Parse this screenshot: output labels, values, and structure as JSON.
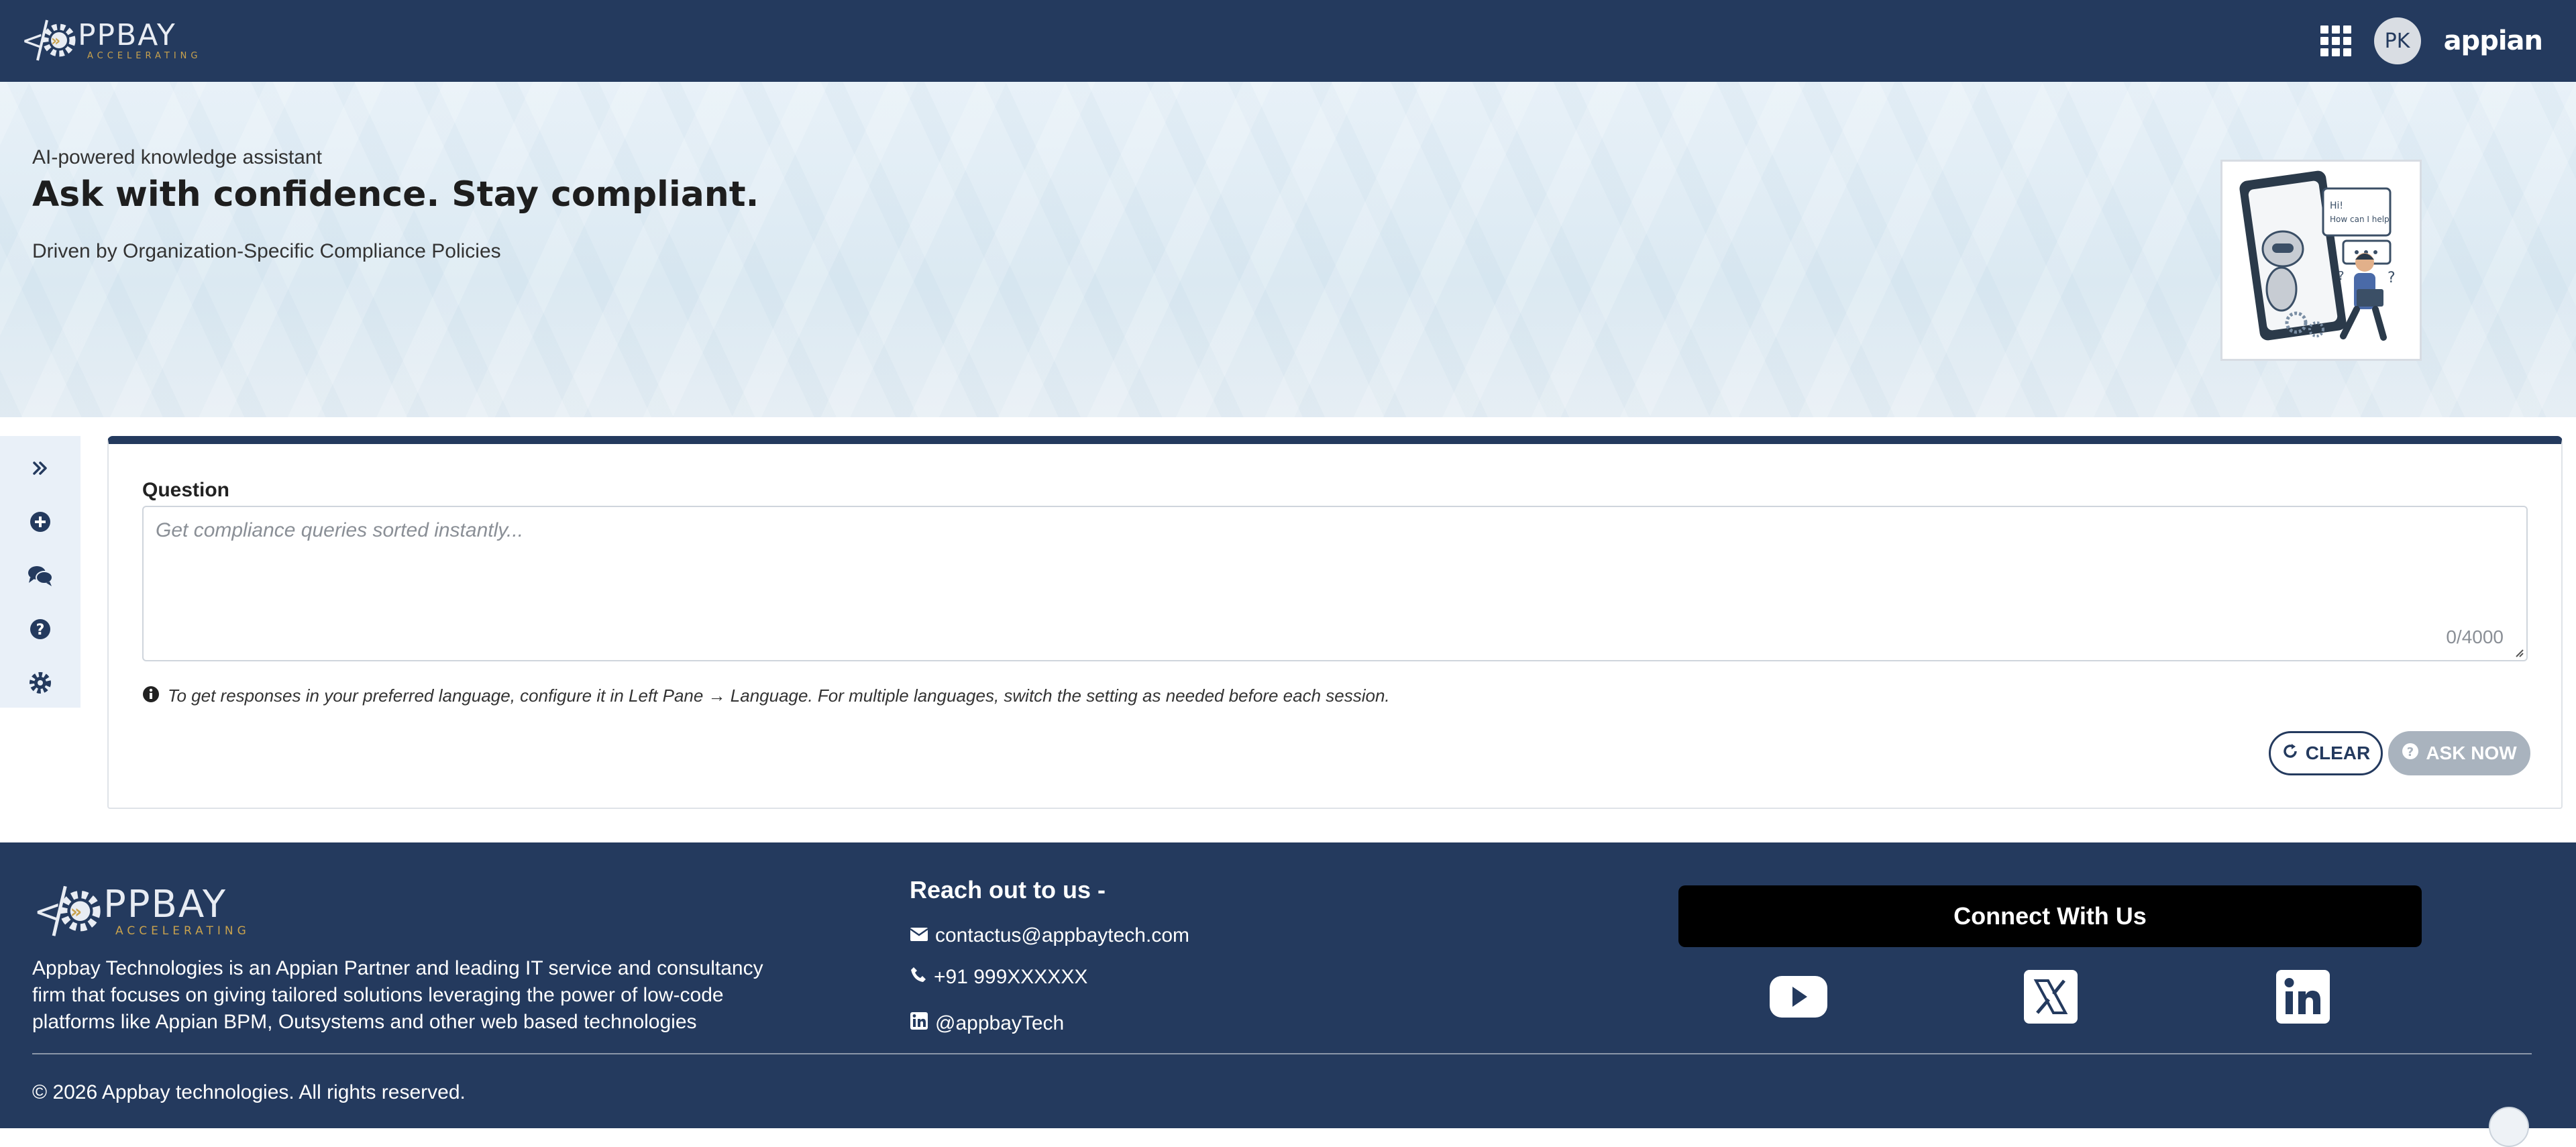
{
  "header": {
    "logo": {
      "name": "PPBAY",
      "tagline": "ACCELERATING"
    },
    "avatar_initials": "PK",
    "brand": "appian"
  },
  "hero": {
    "eyebrow": "AI-powered knowledge assistant",
    "title": "Ask with confidence. Stay compliant.",
    "subtitle": "Driven by Organization-Specific Compliance Policies"
  },
  "left_rail": {
    "icons": [
      "expand-icon",
      "add-circle-icon",
      "chat-icon",
      "help-icon",
      "gear-icon"
    ]
  },
  "question_card": {
    "label": "Question",
    "placeholder": "Get compliance queries sorted instantly...",
    "counter": "0/4000",
    "info": "To get responses in your preferred language, configure it in Left Pane → Language. For multiple languages, switch the setting as needed before each session.",
    "clear_label": "CLEAR",
    "ask_label": "ASK NOW"
  },
  "footer": {
    "logo": {
      "name": "PPBAY",
      "tagline": "ACCELERATING"
    },
    "description": "Appbay Technologies is an Appian Partner and leading IT service and consultancy firm that focuses on giving tailored solutions leveraging the power of low-code platforms like Appian BPM, Outsystems and other web based technologies",
    "reach_title": "Reach out to us -",
    "email": "contactus@appbaytech.com",
    "phone": "+91 999XXXXXX",
    "linkedin": "@appbayTech",
    "connect_title": "Connect With Us",
    "social": [
      "youtube-icon",
      "x-icon",
      "linkedin-icon"
    ],
    "copyright": "© 2026 Appbay technologies. All rights reserved."
  },
  "colors": {
    "navy": "#243a5e",
    "gold": "#c9a24d",
    "disabled": "#a9b3be"
  }
}
